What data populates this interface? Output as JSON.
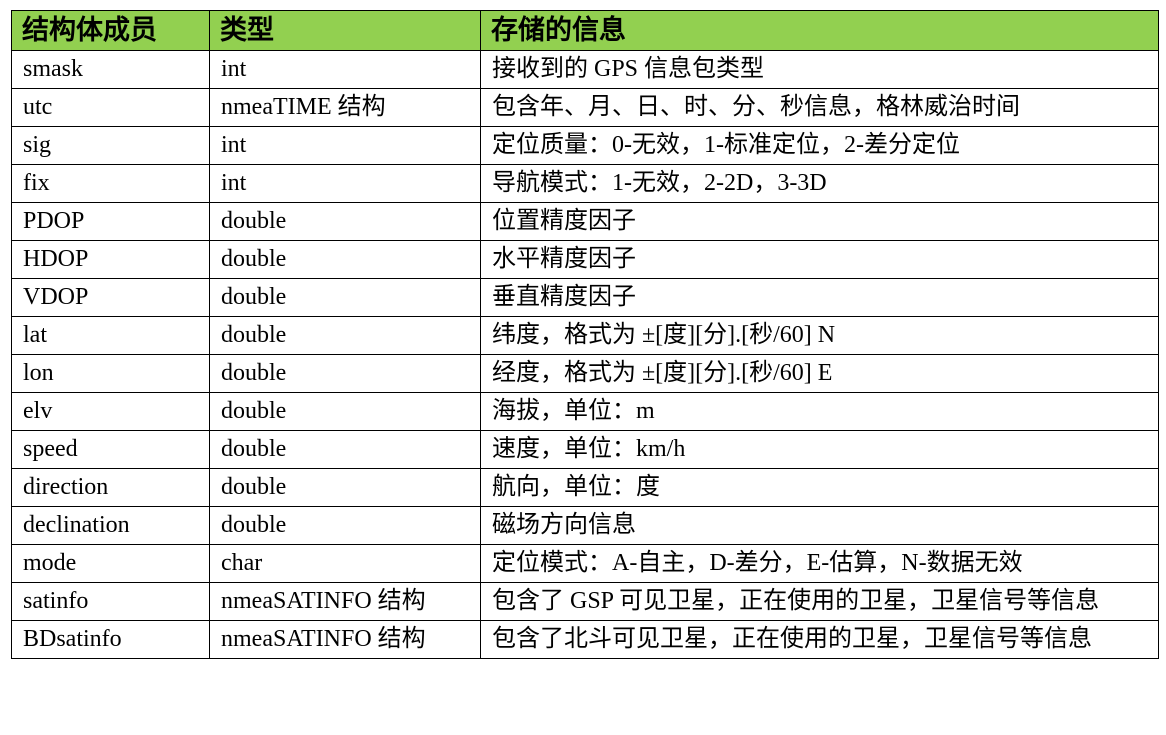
{
  "headers": [
    "结构体成员",
    "类型",
    "存储的信息"
  ],
  "rows": [
    {
      "member": "smask",
      "type": "int",
      "info": "接收到的 GPS 信息包类型"
    },
    {
      "member": "utc",
      "type": "nmeaTIME 结构",
      "info": "包含年、月、日、时、分、秒信息，格林威治时间"
    },
    {
      "member": "sig",
      "type": "int",
      "info": "定位质量：0-无效，1-标准定位，2-差分定位"
    },
    {
      "member": "fix",
      "type": "int",
      "info": "导航模式：1-无效，2-2D，3-3D"
    },
    {
      "member": "PDOP",
      "type": "double",
      "info": "位置精度因子"
    },
    {
      "member": "HDOP",
      "type": "double",
      "info": "水平精度因子"
    },
    {
      "member": "VDOP",
      "type": "double",
      "info": "垂直精度因子"
    },
    {
      "member": "lat",
      "type": "double",
      "info": "纬度，格式为 ±[度][分].[秒/60]  N"
    },
    {
      "member": "lon",
      "type": "double",
      "info": "经度，格式为 ±[度][分].[秒/60]  E"
    },
    {
      "member": "elv",
      "type": "double",
      "info": "海拔，单位：m"
    },
    {
      "member": "speed",
      "type": "double",
      "info": "速度，单位：km/h"
    },
    {
      "member": "direction",
      "type": "double",
      "info": "航向，单位：度"
    },
    {
      "member": "declination",
      "type": "double",
      "info": "磁场方向信息"
    },
    {
      "member": "mode",
      "type": "char",
      "info": "定位模式：A-自主，D-差分，E-估算，N-数据无效"
    },
    {
      "member": "satinfo",
      "type": "nmeaSATINFO 结构",
      "info": "包含了 GSP 可见卫星，正在使用的卫星，卫星信号等信息"
    },
    {
      "member": "BDsatinfo",
      "type": "nmeaSATINFO 结构",
      "info": "包含了北斗可见卫星，正在使用的卫星，卫星信号等信息"
    }
  ]
}
